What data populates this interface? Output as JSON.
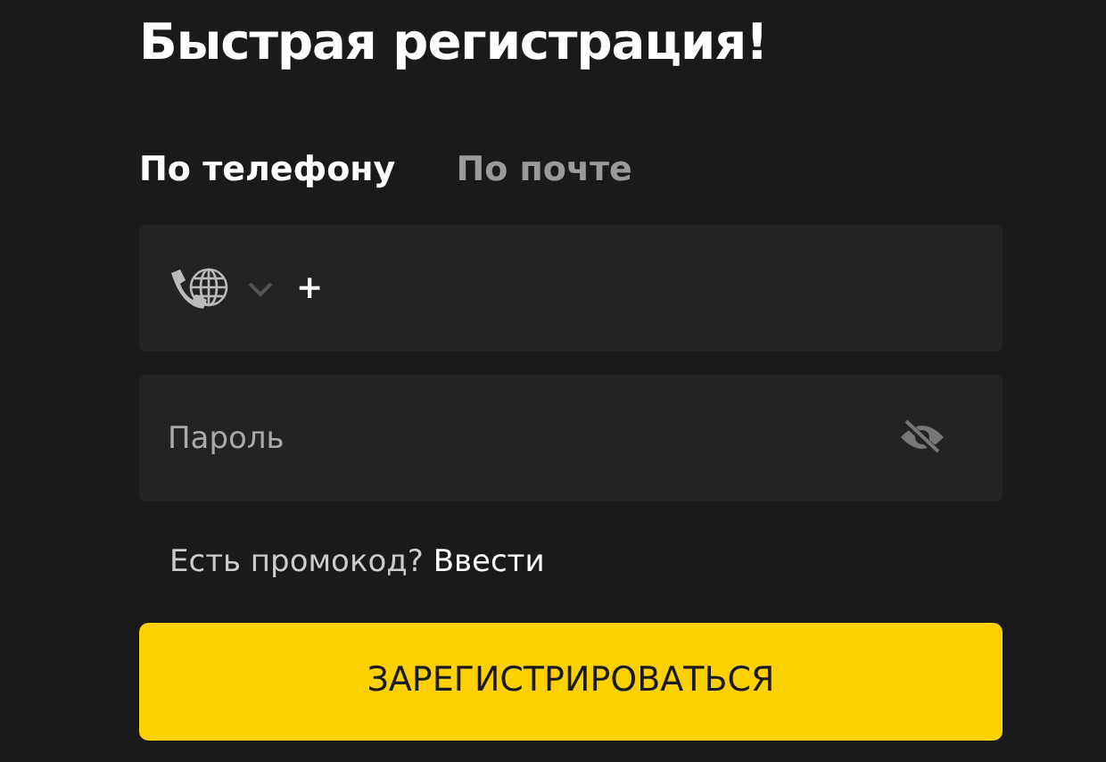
{
  "title": "Быстрая регистрация!",
  "tabs": [
    {
      "label": "По телефону",
      "selected": true
    },
    {
      "label": "По почте",
      "selected": false
    }
  ],
  "phone_field": {
    "prefix": "+"
  },
  "password_field": {
    "placeholder": "Пароль"
  },
  "promo": {
    "text": "Есть промокод?",
    "link": "Ввести"
  },
  "submit_button": "ЗАРЕГИСТРИРОВАТЬСЯ"
}
